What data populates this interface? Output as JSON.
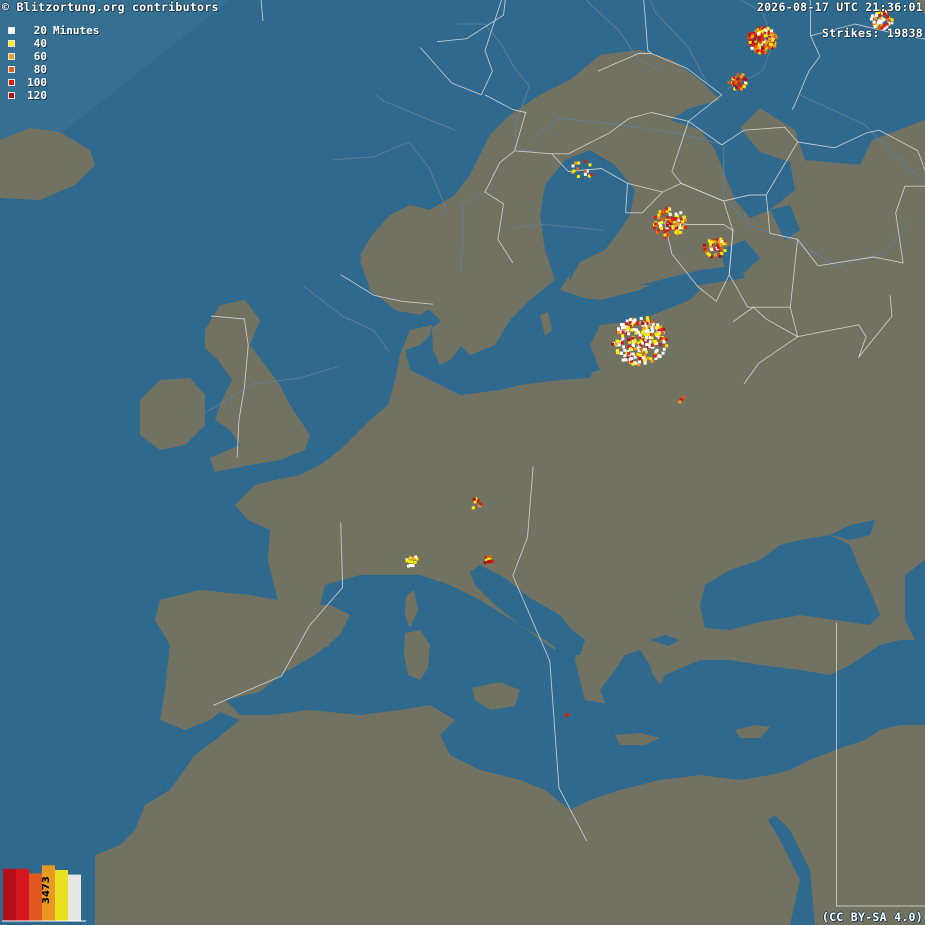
{
  "header": {
    "credit": "© Blitzortung.org contributors",
    "timestamp": "2026-08-17 UTC 21:36:01",
    "strikes_label": "Strikes: 19838"
  },
  "footer": {
    "license": "(CC BY-SA 4.0)"
  },
  "legend": {
    "unit": "Minutes",
    "items": [
      {
        "label": "20",
        "color": "#ffffff"
      },
      {
        "label": "40",
        "color": "#ffee00"
      },
      {
        "label": "60",
        "color": "#f0a020"
      },
      {
        "label": "80",
        "color": "#e06010"
      },
      {
        "label": "100",
        "color": "#d42010"
      },
      {
        "label": "120",
        "color": "#b01010"
      }
    ]
  },
  "histogram": {
    "count_label": "3473",
    "bars": [
      {
        "fraction": 0.9,
        "color": "#b81018"
      },
      {
        "fraction": 0.9,
        "color": "#d81820"
      },
      {
        "fraction": 0.82,
        "color": "#e05820"
      },
      {
        "fraction": 0.96,
        "color": "#e89a20"
      },
      {
        "fraction": 0.88,
        "color": "#e8e020"
      },
      {
        "fraction": 0.8,
        "color": "#e8e8e8"
      }
    ]
  },
  "colors": {
    "sea": "#2f6a8e",
    "land": "#727262",
    "border": "#d8d8d8",
    "river": "#5f7f96"
  },
  "strike_clusters": [
    {
      "name": "central-italy",
      "lon": 14.3,
      "lat": 41.2,
      "spread": 1.5,
      "count": 260,
      "mix": [
        0.45,
        0.2,
        0.1,
        0.05,
        0.15,
        0.05
      ]
    },
    {
      "name": "poland-east",
      "lon": 20.9,
      "lat": 51.4,
      "spread": 0.8,
      "count": 150,
      "mix": [
        0.1,
        0.15,
        0.2,
        0.15,
        0.3,
        0.1
      ]
    },
    {
      "name": "poland-south",
      "lon": 19.6,
      "lat": 50.0,
      "spread": 0.5,
      "count": 40,
      "mix": [
        0.05,
        0.1,
        0.15,
        0.2,
        0.3,
        0.2
      ]
    },
    {
      "name": "belarus",
      "lon": 27.4,
      "lat": 52.1,
      "spread": 0.6,
      "count": 60,
      "mix": [
        0.35,
        0.2,
        0.15,
        0.1,
        0.15,
        0.05
      ]
    },
    {
      "name": "croatia",
      "lon": 15.9,
      "lat": 45.2,
      "spread": 0.9,
      "count": 90,
      "mix": [
        0.15,
        0.2,
        0.15,
        0.1,
        0.3,
        0.1
      ]
    },
    {
      "name": "bosnia-serbia",
      "lon": 18.4,
      "lat": 44.3,
      "spread": 0.7,
      "count": 40,
      "mix": [
        0.15,
        0.25,
        0.15,
        0.1,
        0.25,
        0.1
      ]
    },
    {
      "name": "alps",
      "lon": 11.2,
      "lat": 47.0,
      "spread": 0.6,
      "count": 14,
      "mix": [
        0.1,
        0.4,
        0.3,
        0.1,
        0.1,
        0.0
      ]
    },
    {
      "name": "algeria-west",
      "lon": 2.0,
      "lat": 33.7,
      "spread": 0.4,
      "count": 14,
      "mix": [
        0.3,
        0.4,
        0.1,
        0.0,
        0.2,
        0.0
      ]
    },
    {
      "name": "algeria-central",
      "lon": 6.1,
      "lat": 33.8,
      "spread": 0.3,
      "count": 10,
      "mix": [
        0.0,
        0.2,
        0.0,
        0.2,
        0.4,
        0.2
      ]
    },
    {
      "name": "algeria-north",
      "lon": 5.4,
      "lat": 35.7,
      "spread": 0.3,
      "count": 8,
      "mix": [
        0.0,
        0.3,
        0.2,
        0.0,
        0.3,
        0.2
      ]
    },
    {
      "name": "black-sea-east",
      "lon": 41.6,
      "lat": 42.6,
      "spread": 0.4,
      "count": 6,
      "mix": [
        0.0,
        0.3,
        0.1,
        0.2,
        0.4,
        0.0
      ]
    },
    {
      "name": "turkey-east",
      "lon": 37.2,
      "lat": 40.0,
      "spread": 0.3,
      "count": 5,
      "mix": [
        0.0,
        0.0,
        0.2,
        0.4,
        0.4,
        0.0
      ]
    },
    {
      "name": "calabria",
      "lon": 16.6,
      "lat": 39.2,
      "spread": 0.2,
      "count": 4,
      "mix": [
        0.0,
        0.0,
        0.3,
        0.3,
        0.4,
        0.0
      ]
    },
    {
      "name": "libya",
      "lon": 10.4,
      "lat": 28.5,
      "spread": 0.1,
      "count": 2,
      "mix": [
        0.0,
        0.0,
        0.0,
        0.0,
        1.0,
        0.0
      ]
    }
  ]
}
